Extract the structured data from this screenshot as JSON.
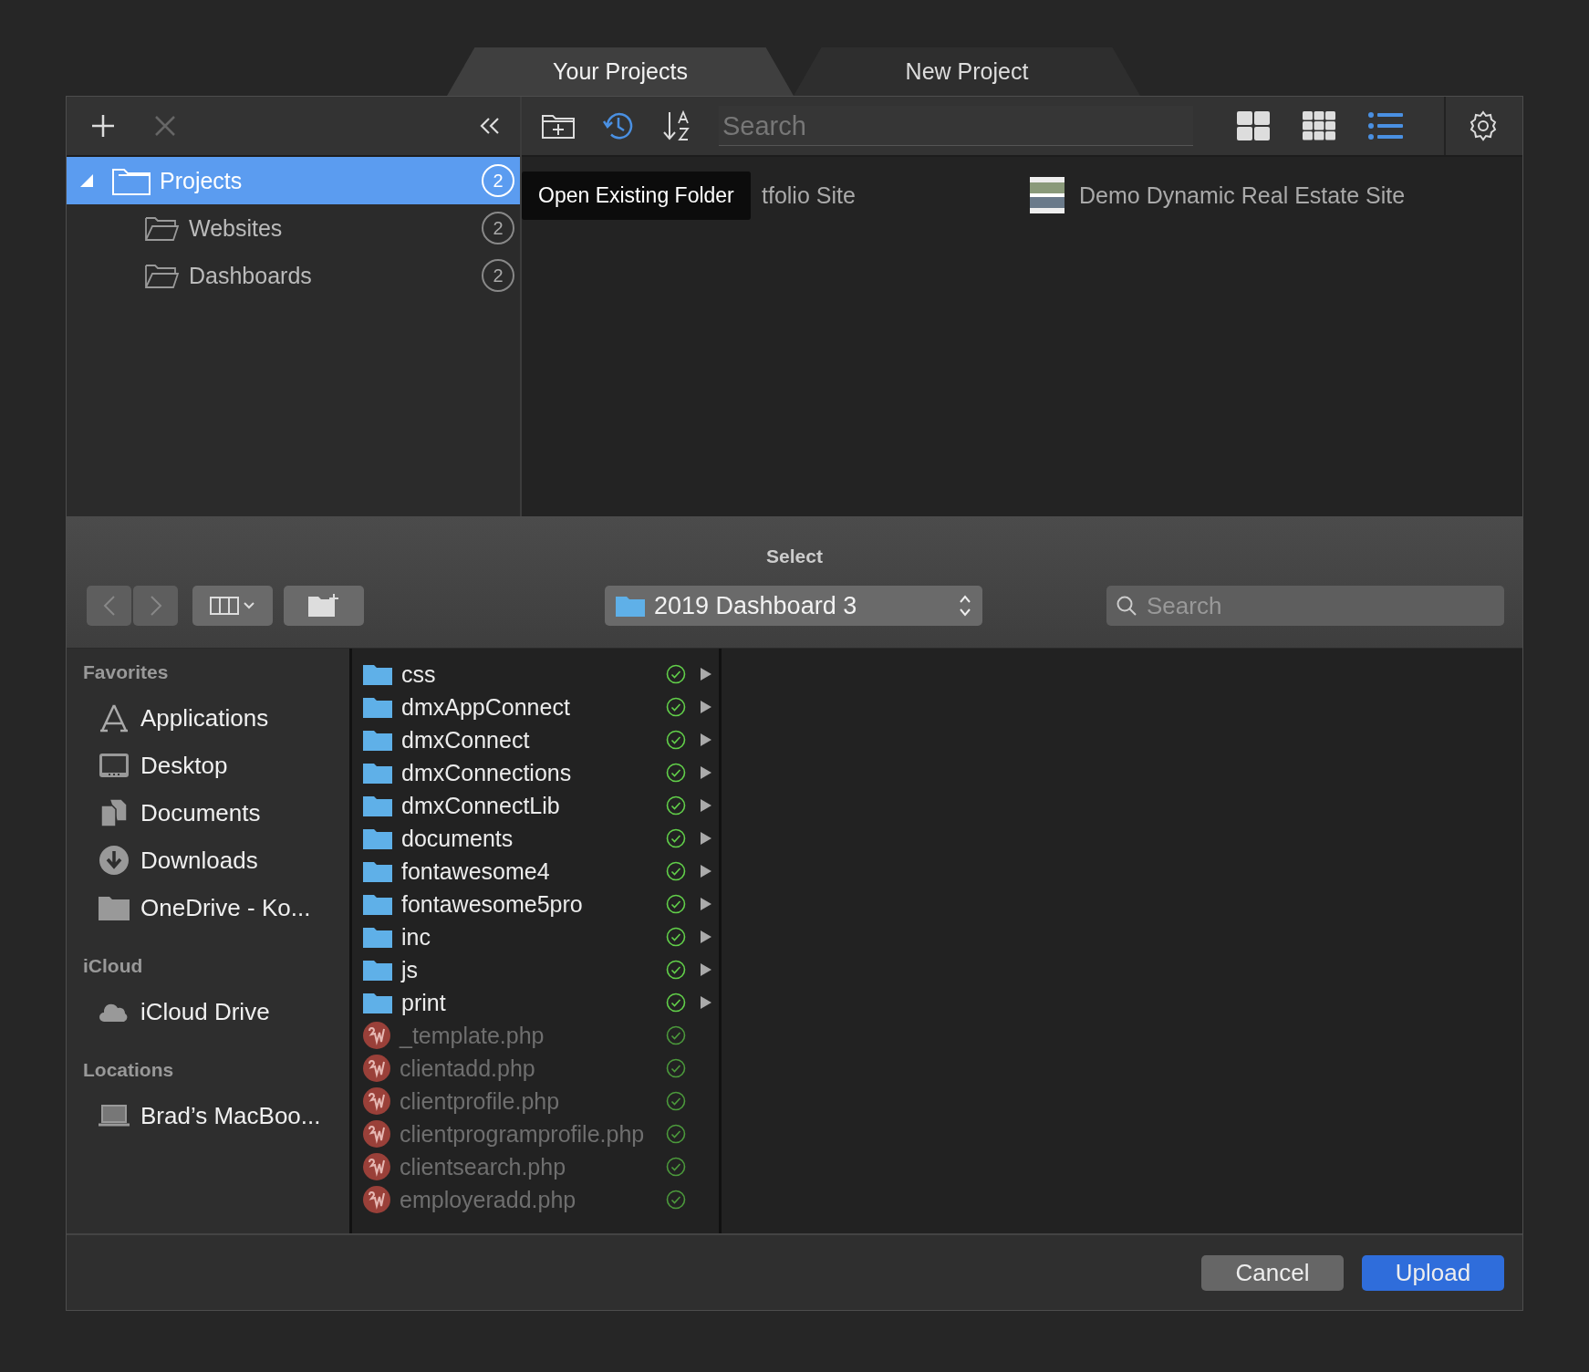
{
  "tabs": [
    {
      "label": "Your Projects",
      "selected": true
    },
    {
      "label": "New Project",
      "selected": false
    }
  ],
  "project_toolbar": {
    "search": {
      "placeholder": "Search"
    },
    "view_modes": [
      {
        "kind": "large-grid",
        "selected": false
      },
      {
        "kind": "small-grid",
        "selected": false
      },
      {
        "kind": "list",
        "selected": true
      }
    ]
  },
  "project_tree": [
    {
      "label": "Projects",
      "count": "2",
      "selected": true,
      "expanded": true,
      "children": [
        {
          "label": "Websites",
          "count": "2",
          "selected": false
        },
        {
          "label": "Dashboards",
          "count": "2",
          "selected": false
        }
      ]
    }
  ],
  "tooltip": "Open Existing Folder",
  "projects": [
    {
      "name": "tfolio Site",
      "kind": "covered"
    },
    {
      "name": "Demo Dynamic Real Estate Site",
      "kind": "thumbnail"
    }
  ],
  "dialog": {
    "title": "Select",
    "location": "2019 Dashboard 3",
    "search": {
      "placeholder": "Search"
    },
    "sidebar": [
      {
        "heading": "Favorites",
        "items": [
          {
            "label": "Applications",
            "kind": "applications"
          },
          {
            "label": "Desktop",
            "kind": "desktop"
          },
          {
            "label": "Documents",
            "kind": "documents"
          },
          {
            "label": "Downloads",
            "kind": "downloads"
          },
          {
            "label": "OneDrive - Ko...",
            "kind": "folder"
          }
        ]
      },
      {
        "heading": "iCloud",
        "items": [
          {
            "label": "iCloud Drive",
            "kind": "cloud"
          }
        ]
      },
      {
        "heading": "Locations",
        "items": [
          {
            "label": "Brad’s MacBoo...",
            "kind": "laptop"
          }
        ]
      }
    ],
    "files": [
      {
        "name": "css",
        "kind": "folder",
        "disabled": false
      },
      {
        "name": "dmxAppConnect",
        "kind": "folder",
        "disabled": false
      },
      {
        "name": "dmxConnect",
        "kind": "folder",
        "disabled": false
      },
      {
        "name": "dmxConnections",
        "kind": "folder",
        "disabled": false
      },
      {
        "name": "dmxConnectLib",
        "kind": "folder",
        "disabled": false
      },
      {
        "name": "documents",
        "kind": "folder",
        "disabled": false
      },
      {
        "name": "fontawesome4",
        "kind": "folder",
        "disabled": false
      },
      {
        "name": "fontawesome5pro",
        "kind": "folder",
        "disabled": false
      },
      {
        "name": "inc",
        "kind": "folder",
        "disabled": false
      },
      {
        "name": "js",
        "kind": "folder",
        "disabled": false
      },
      {
        "name": "print",
        "kind": "folder",
        "disabled": false
      },
      {
        "name": "_template.php",
        "kind": "php",
        "disabled": true
      },
      {
        "name": "clientadd.php",
        "kind": "php",
        "disabled": true
      },
      {
        "name": "clientprofile.php",
        "kind": "php",
        "disabled": true
      },
      {
        "name": "clientprogramprofile.php",
        "kind": "php",
        "disabled": true
      },
      {
        "name": "clientsearch.php",
        "kind": "php",
        "disabled": true
      },
      {
        "name": "employeradd.php",
        "kind": "php",
        "disabled": true
      }
    ],
    "buttons": [
      {
        "label": "Cancel",
        "kind": "secondary"
      },
      {
        "label": "Upload",
        "kind": "primary"
      }
    ]
  }
}
